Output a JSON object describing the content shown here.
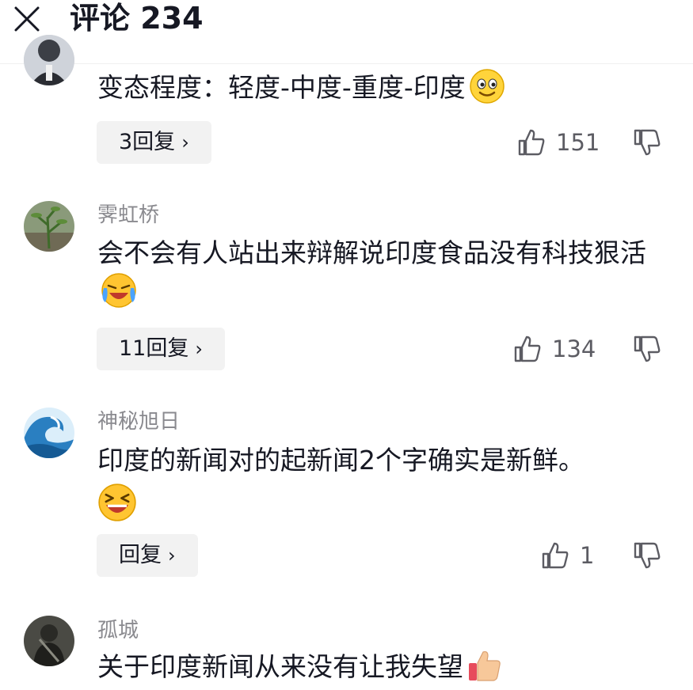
{
  "header": {
    "title": "评论 234"
  },
  "comments": [
    {
      "username": "",
      "text": "变态程度：轻度-中度-重度-印度",
      "reply_label": "3回复",
      "likes": "151"
    },
    {
      "username": "霁虹桥",
      "text": "会不会有人站出来辩解说印度食品没有科技狠活",
      "reply_label": "11回复",
      "likes": "134"
    },
    {
      "username": "神秘旭日",
      "text": "印度的新闻对的起新闻2个字确实是新鲜。",
      "reply_label": "回复",
      "likes": "1"
    },
    {
      "username": "孤城",
      "text": "关于印度新闻从来没有让我失望",
      "reply_label": "",
      "likes": ""
    }
  ],
  "colors": {
    "text": "#161823",
    "secondary": "#8a8a8f",
    "reply_bg": "#f2f2f2"
  }
}
